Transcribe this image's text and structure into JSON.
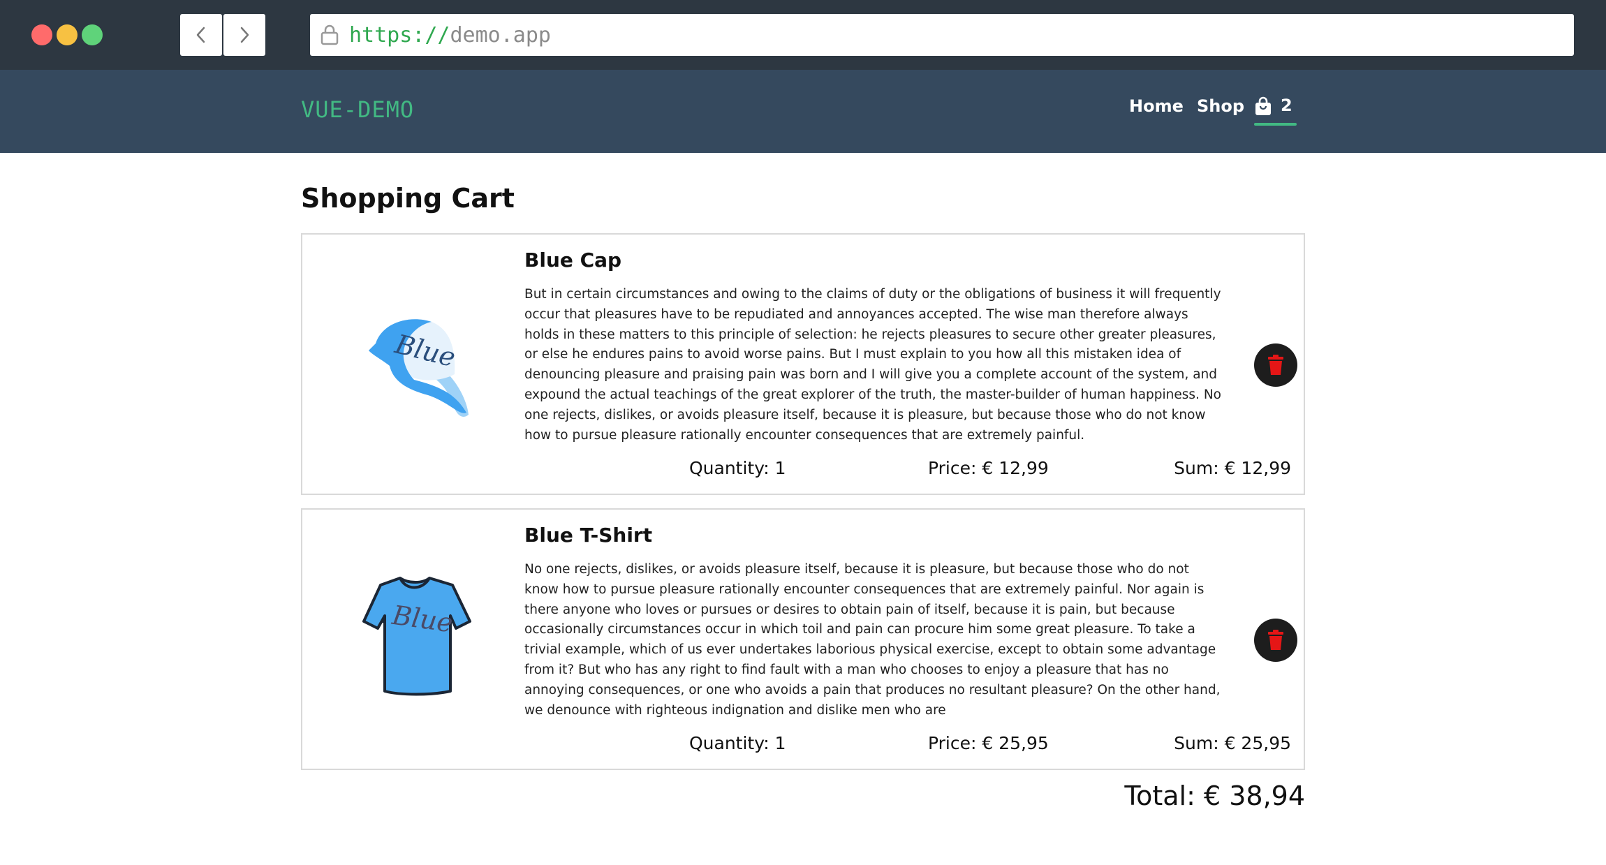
{
  "browser": {
    "url_scheme": "https://",
    "url_host": "demo.app"
  },
  "header": {
    "brand": "VUE-DEMO",
    "nav": {
      "home": "Home",
      "shop": "Shop"
    },
    "cart_count": "2",
    "accent_color": "#42b983",
    "bg_color": "#35495e"
  },
  "page": {
    "title": "Shopping Cart",
    "total": "Total: € 38,94"
  },
  "items": [
    {
      "name": "Blue Cap",
      "image_text": "Blue",
      "description": "But in certain circumstances and owing to the claims of duty or the obligations of business it will frequently occur that pleasures have to be repudiated and annoyances accepted. The wise man therefore always holds in these matters to this principle of selection: he rejects pleasures to secure other greater pleasures, or else he endures pains to avoid worse pains. But I must explain to you how all this mistaken idea of denouncing pleasure and praising pain was born and I will give you a complete account of the system, and expound the actual teachings of the great explorer of the truth, the master-builder of human happiness. No one rejects, dislikes, or avoids pleasure itself, because it is pleasure, but because those who do not know how to pursue pleasure rationally encounter consequences that are extremely painful.",
      "quantity": "Quantity: 1",
      "price": "Price: € 12,99",
      "sum": "Sum: € 12,99",
      "icon": "trash-icon"
    },
    {
      "name": "Blue T-Shirt",
      "image_text": "Blue",
      "description": "No one rejects, dislikes, or avoids pleasure itself, because it is pleasure, but because those who do not know how to pursue pleasure rationally encounter consequences that are extremely painful. Nor again is there anyone who loves or pursues or desires to obtain pain of itself, because it is pain, but because occasionally circumstances occur in which toil and pain can procure him some great pleasure. To take a trivial example, which of us ever undertakes laborious physical exercise, except to obtain some advantage from it? But who has any right to find fault with a man who chooses to enjoy a pleasure that has no annoying consequences, or one who avoids a pain that produces no resultant pleasure? On the other hand, we denounce with righteous indignation and dislike men who are",
      "quantity": "Quantity: 1",
      "price": "Price: € 25,95",
      "sum": "Sum: € 25,95",
      "icon": "trash-icon"
    }
  ]
}
